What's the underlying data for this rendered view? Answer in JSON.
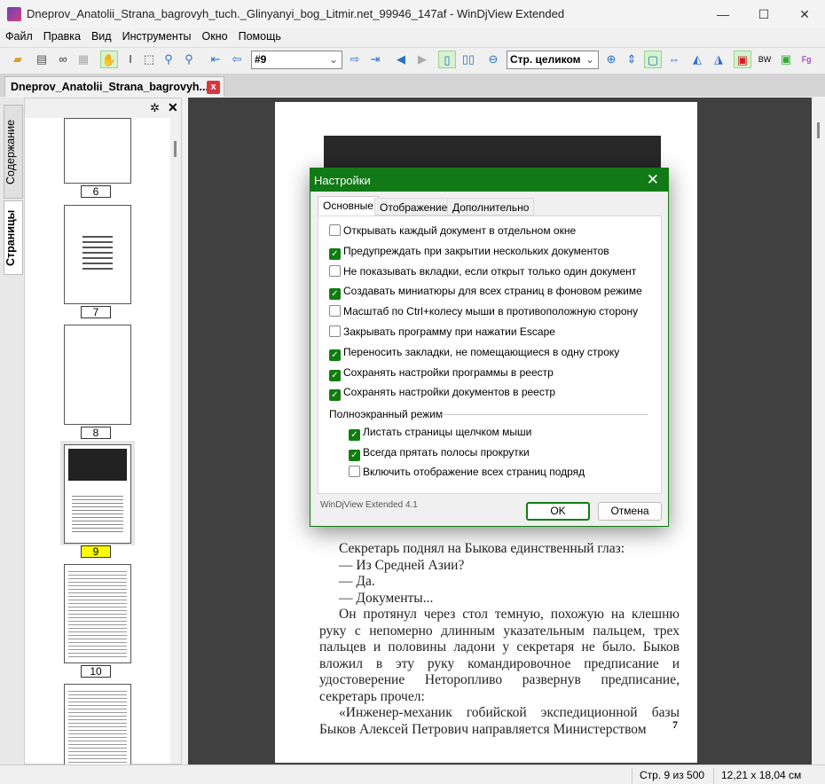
{
  "window": {
    "title": "Dneprov_Anatolii_Strana_bagrovyh_tuch._Glinyanyi_bog_Litmir.net_99946_147af - WinDjView Extended",
    "minimize": "—",
    "maximize": "☐",
    "close": "✕"
  },
  "menu": [
    "Файл",
    "Правка",
    "Вид",
    "Инструменты",
    "Окно",
    "Помощь"
  ],
  "toolbar": {
    "page_value": "#9",
    "zoom_value": "Стр. целиком"
  },
  "tab": {
    "label": "Dneprov_Anatolii_Strana_bagrovyh...",
    "close": "x"
  },
  "side_tabs": {
    "contents": "Содержание",
    "pages": "Страницы"
  },
  "thumbnails": [
    {
      "label": "6"
    },
    {
      "label": "7"
    },
    {
      "label": "8"
    },
    {
      "label": "9",
      "selected": true
    },
    {
      "label": "10"
    }
  ],
  "page": {
    "paragraphs": [
      "Секретарь поднял на Быкова единственный глаз:",
      "— Из Средней Азии?",
      "— Да.",
      "— Документы...",
      "Он протянул через стол темную, похожую на клешню руку с непомерно длинным указательным пальцем, трех пальцев и половины ладони у секретаря не было. Быков вложил в эту руку командировочное предписание и удостоверение Неторопливо развернув предписание, секретарь прочел:",
      "«Инженер-механик гобийской экспедиционной базы Быков Алексей Петрович направляется Министерством"
    ],
    "number": "7"
  },
  "status": {
    "page": "Стр. 9 из 500",
    "size": "12,21 x 18,04 см"
  },
  "dialog": {
    "title": "Настройки",
    "close": "✕",
    "tabs": [
      "Основные",
      "Отображение",
      "Дополнительно"
    ],
    "options": [
      {
        "label": "Открывать каждый документ в отдельном окне",
        "checked": false
      },
      {
        "label": "Предупреждать при закрытии нескольких документов",
        "checked": true
      },
      {
        "label": "Не показывать вкладки, если открыт только один документ",
        "checked": false
      },
      {
        "label": "Создавать миниатюры для всех страниц в фоновом режиме",
        "checked": true
      },
      {
        "label": "Масштаб по Ctrl+колесу мыши в противоположную сторону",
        "checked": false
      },
      {
        "label": "Закрывать программу при нажатии Escape",
        "checked": false
      },
      {
        "label": "Переносить закладки, не помещающиеся в одну строку",
        "checked": true
      },
      {
        "label": "Сохранять настройки программы в реестр",
        "checked": true
      },
      {
        "label": "Сохранять настройки документов в реестр",
        "checked": true
      }
    ],
    "fullscreen_group": "Полноэкранный режим",
    "fullscreen_options": [
      {
        "label": "Листать страницы щелчком мыши",
        "checked": true
      },
      {
        "label": "Всегда прятать полосы прокрутки",
        "checked": true
      },
      {
        "label": "Включить отображение всех страниц подряд",
        "checked": false
      }
    ],
    "version": "WinDjView Extended 4.1",
    "ok": "OK",
    "cancel": "Отмена"
  },
  "colors": {
    "accent": "#107c10",
    "viewer_bg": "#404040",
    "selected_page": "#ffff00"
  }
}
